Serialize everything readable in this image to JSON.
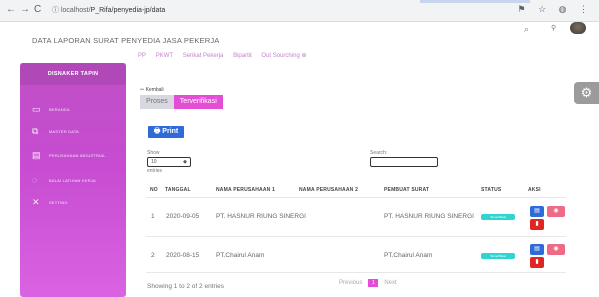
{
  "browser": {
    "back": "←",
    "forward": "→",
    "reload": "C",
    "url_prefix": "ⓘ localhost/",
    "url": "P_Rifa/penyedia-jp/data",
    "right_icons": "⚑ ☆ ◍ ⋮"
  },
  "page": {
    "title": "DATA LAPORAN SURAT PENYEDIA JASA PEKERJA",
    "top_tabs": [
      "PP",
      "PKWT",
      "Serikat Pekerja",
      "Bipartit",
      "Out Sourching ⊕"
    ]
  },
  "sidebar": {
    "header": "DISNAKER TAPIN",
    "items": [
      {
        "label": "BERANDA",
        "icon": "monitor-icon",
        "glyph": "▭"
      },
      {
        "label": "MASTER DATA",
        "icon": "layers-icon",
        "glyph": "⧉"
      },
      {
        "label": "PERUSAHAAN INDUSTRIAL",
        "icon": "document-icon",
        "glyph": "▤"
      },
      {
        "label": "BALAI LATIHAN KERJA",
        "icon": "chat-icon",
        "glyph": "◌"
      },
      {
        "label": "SETTING",
        "icon": "tools-icon",
        "glyph": "✕"
      }
    ]
  },
  "content": {
    "back_link": "⇦ Kembali",
    "filter_tabs": [
      "Proses",
      "Terverifikasi"
    ],
    "print_label": "🖶 Print",
    "show_label": "Show",
    "show_value": "10",
    "entries_label": "entries",
    "search_label": "Search:",
    "table": {
      "headers": [
        "NO",
        "TANGGAL",
        "NAMA PERUSAHAAN 1",
        "NAMA PERUSAHAAN 2",
        "PEMBUAT SURAT",
        "STATUS",
        "AKSI"
      ],
      "rows": [
        {
          "no": "1",
          "tanggal": "2020-09-05",
          "perusahaan1": "PT. HASNUR RIUNG SINERGI",
          "perusahaan2": "",
          "pembuat": "PT. HASNUR RIUNG SINERGI",
          "status": "Terverifikasi"
        },
        {
          "no": "2",
          "tanggal": "2020-08-15",
          "perusahaan1": "PT.Chairul Anam",
          "perusahaan2": "",
          "pembuat": "PT.Chairul Anam",
          "status": "Terverifikasi"
        }
      ]
    },
    "footer_info": "Showing 1 to 2 of 2 entries",
    "pager": {
      "previous": "Previous",
      "page": "1",
      "next": "Next"
    }
  },
  "colors": {
    "sidebar": "#c74cd1",
    "accent": "#e24fd5",
    "print": "#2f6bd8",
    "status": "#30d5d2",
    "delete": "#e02525"
  }
}
